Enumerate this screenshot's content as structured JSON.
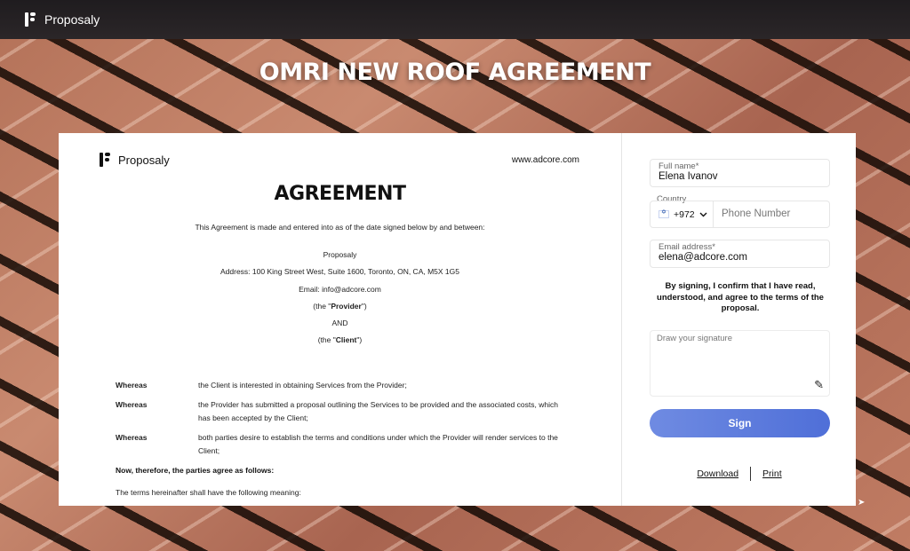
{
  "app": {
    "brand": "Proposaly"
  },
  "headline": "OMRI NEW ROOF AGREEMENT",
  "document": {
    "brand": "Proposaly",
    "url": "www.adcore.com",
    "title": "AGREEMENT",
    "intro": "This Agreement is made and entered into as of the date signed below by and between:",
    "provider_name": "Proposaly",
    "address": "Address: 100 King Street West, Suite 1600, Toronto, ON, CA, M5X 1G5",
    "email": "Email: info@adcore.com",
    "provider_pre": "(the \"",
    "provider_word": "Provider",
    "provider_post": "\")",
    "and": "AND",
    "client_pre": "(the \"",
    "client_word": "Client",
    "client_post": "\")",
    "clauses": [
      {
        "key": "Whereas",
        "text": "the Client is interested in obtaining Services from the Provider;"
      },
      {
        "key": "Whereas",
        "text": "the Provider has submitted a proposal outlining the Services to be provided and the associated costs, which has been accepted by the Client;"
      },
      {
        "key": "Whereas",
        "text": "both parties desire to establish the terms and conditions under which the Provider will render services to the Client;"
      }
    ],
    "now_therefore": "Now, therefore, the parties agree as follows:",
    "terms_line": "The terms hereinafter shall have the following meaning:"
  },
  "form": {
    "full_name_label": "Full name*",
    "full_name_value": "Elena Ivanov",
    "country_label": "Country",
    "country_code": "+972",
    "phone_placeholder": "Phone Number",
    "email_label": "Email address*",
    "email_value": "elena@adcore.com",
    "consent": "By signing, I confirm that I have read, understood, and agree to the terms of the proposal.",
    "signature_label": "Draw your signature",
    "sign_button": "Sign",
    "download_link": "Download",
    "print_link": "Print"
  },
  "colors": {
    "sign_button": "#5b7bdc",
    "topbar": "#231f22"
  },
  "icons": {
    "logo": "proposaly-logo-icon",
    "flag": "israel-flag-icon",
    "chevron": "chevron-down-icon",
    "pen": "pen-icon"
  }
}
